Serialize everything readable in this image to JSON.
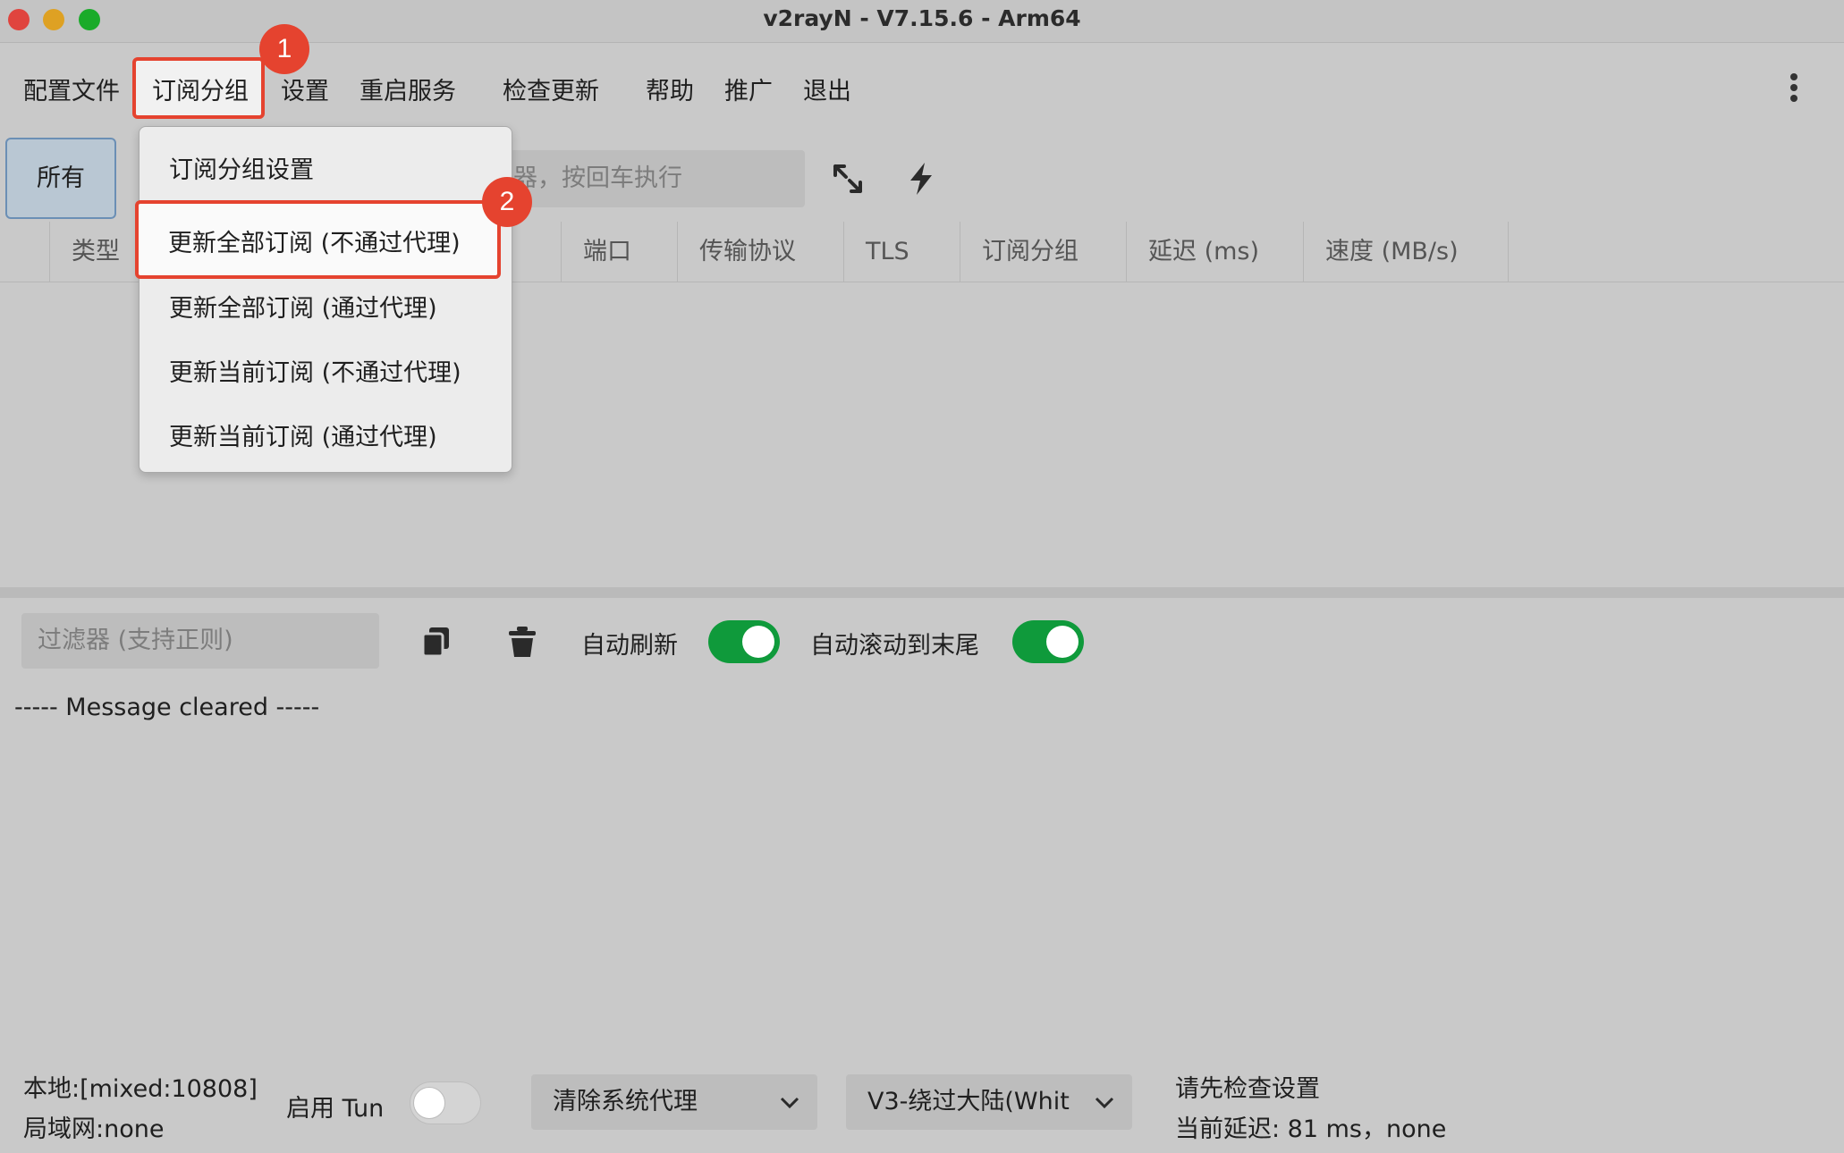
{
  "window": {
    "title": "v2rayN - V7.15.6 - Arm64"
  },
  "menubar": {
    "items": [
      "配置文件",
      "订阅分组",
      "设置",
      "重启服务",
      "检查更新",
      "帮助",
      "推广",
      "退出"
    ],
    "active_index": 1
  },
  "annotations": {
    "badge1": "1",
    "badge2": "2",
    "color": "#e5432f"
  },
  "dropdown": {
    "items": [
      "订阅分组设置",
      "更新全部订阅 (不通过代理)",
      "更新全部订阅 (通过代理)",
      "更新当前订阅 (不通过代理)",
      "更新当前订阅 (通过代理)"
    ],
    "highlighted_index": 1
  },
  "toolbar": {
    "all_label": "所有",
    "search_placeholder_visible": "器，按回车执行",
    "expand_icon": "expand-icon",
    "speedtest_icon": "lightning-icon"
  },
  "table": {
    "columns": [
      "类型",
      "端口",
      "传输协议",
      "TLS",
      "订阅分组",
      "延迟 (ms)",
      "速度 (MB/s)"
    ]
  },
  "log": {
    "filter_placeholder": "过滤器 (支持正则)",
    "copy_icon": "copy-icon",
    "clear_icon": "trash-icon",
    "auto_refresh_label": "自动刷新",
    "auto_refresh_on": true,
    "auto_scroll_label": "自动滚动到末尾",
    "auto_scroll_on": true,
    "message": "----- Message cleared -----"
  },
  "statusbar": {
    "local": "本地:[mixed:10808]",
    "lan": "局域网:none",
    "tun_label": "启用 Tun",
    "tun_on": false,
    "system_proxy": "清除系统代理",
    "routing": "V3-绕过大陆(Whit",
    "notice": "请先检查设置",
    "latency": "当前延迟: 81 ms，none"
  },
  "colors": {
    "toggle_on": "#0f9a3b",
    "highlight": "#e5432f",
    "all_button": "#b9c7d3"
  }
}
